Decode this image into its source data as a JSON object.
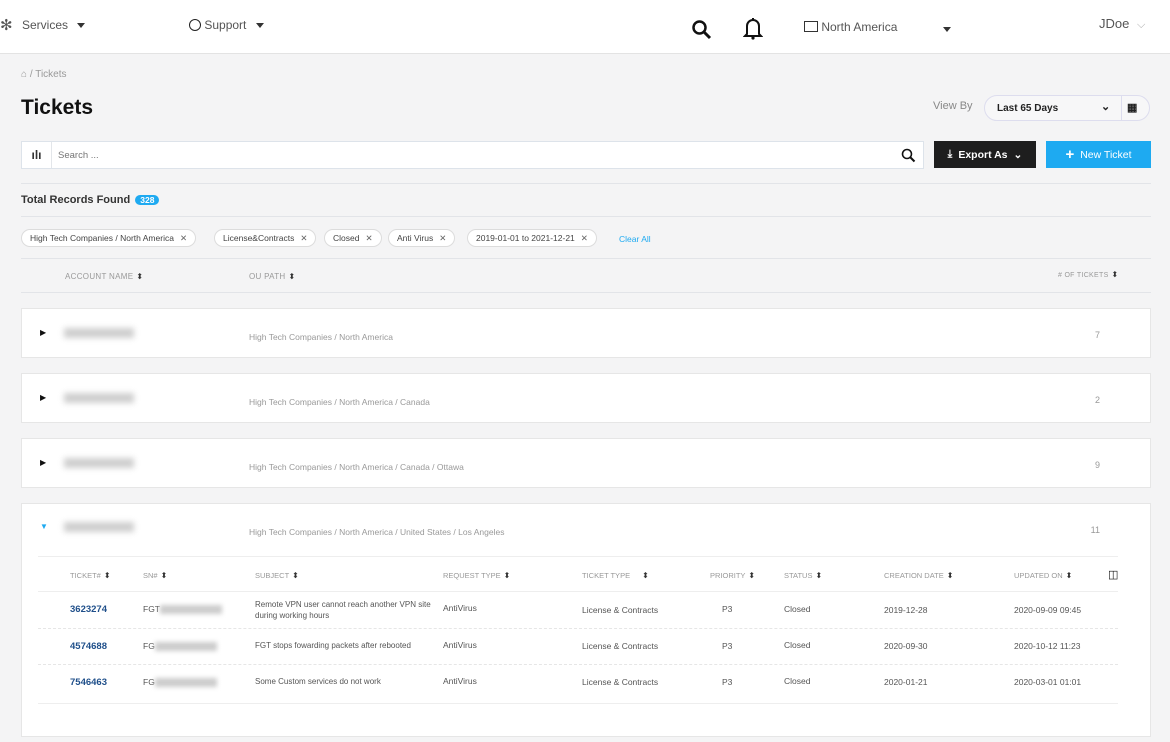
{
  "nav": {
    "services": "Services",
    "support": "Support",
    "region": "North America",
    "user": "JDoe"
  },
  "breadcrumb": {
    "current": "Tickets",
    "separator": "/"
  },
  "page": {
    "title": "Tickets",
    "view_by_label": "View By",
    "view_by_value": "Last 65 Days"
  },
  "search": {
    "placeholder": "Search ..."
  },
  "toolbar": {
    "export": "Export As",
    "new_ticket": "New Ticket"
  },
  "records": {
    "label": "Total Records Found",
    "count": "328"
  },
  "filters": [
    "High Tech Companies / North America",
    "License&Contracts",
    "Closed",
    "Anti Virus",
    "2019-01-01 to 2021-12-21"
  ],
  "clear_all": "Clear All",
  "columns": {
    "account": "ACCOUNT NAME",
    "ou": "OU PATH",
    "tickets": "# OF TICKETS"
  },
  "accounts": [
    {
      "ou": "High Tech Companies / North America",
      "count": "7"
    },
    {
      "ou": "High Tech Companies / North America / Canada",
      "count": "2"
    },
    {
      "ou": "High Tech Companies / North America / Canada / Ottawa",
      "count": "9"
    },
    {
      "ou": "High Tech Companies / North America / United States / Los Angeles",
      "count": "11"
    }
  ],
  "ticket_columns": [
    "TICKET#",
    "SN#",
    "SUBJECT",
    "REQUEST TYPE",
    "TICKET TYPE",
    "PRIORITY",
    "STATUS",
    "CREATION DATE",
    "UPDATED ON"
  ],
  "tickets": [
    {
      "id": "3623274",
      "sn": "FGT",
      "subject": "Remote VPN user cannot reach another VPN site during working hours",
      "request": "AntiVirus",
      "type": "License & Contracts",
      "priority": "P3",
      "status": "Closed",
      "created": "2019-12-28",
      "updated": "2020-09-09 09:45"
    },
    {
      "id": "4574688",
      "sn": "FG",
      "subject": "FGT stops fowarding packets after rebooted",
      "request": "AntiVirus",
      "type": "License & Contracts",
      "priority": "P3",
      "status": "Closed",
      "created": "2020-09-30",
      "updated": "2020-10-12 11:23"
    },
    {
      "id": "7546463",
      "sn": "FG",
      "subject": "Some Custom services do not work",
      "request": "AntiVirus",
      "type": "License & Contracts",
      "priority": "P3",
      "status": "Closed",
      "created": "2020-01-21",
      "updated": "2020-03-01 01:01"
    }
  ],
  "colors": {
    "accent": "#1eaaf1",
    "dark_button": "#1e1e1e",
    "link": "#1f4f8a"
  }
}
